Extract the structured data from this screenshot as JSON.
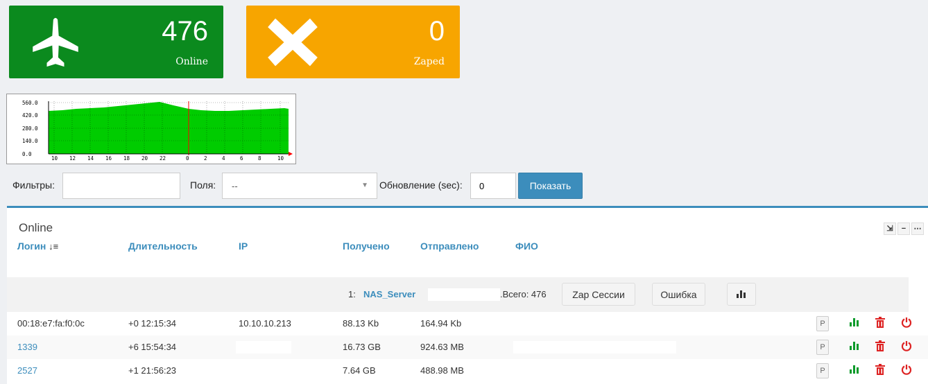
{
  "tiles": {
    "online": {
      "value": "476",
      "label": "Online",
      "icon": "plane-icon",
      "color": "#0b8a1e"
    },
    "zaped": {
      "value": "0",
      "label": "Zaped",
      "icon": "x-icon",
      "color": "#f7a500"
    }
  },
  "graph": {
    "y_ticks": [
      "560.0",
      "420.0",
      "280.0",
      "140.0",
      "0.0"
    ],
    "x_ticks": [
      "10",
      "12",
      "14",
      "16",
      "18",
      "20",
      "22",
      "0",
      "2",
      "4",
      "6",
      "8",
      "10"
    ],
    "fill_color": "#00cc00"
  },
  "filters": {
    "filter_label": "Фильтры:",
    "filter_value": "",
    "fields_label": "Поля:",
    "fields_value": "--",
    "refresh_label": "Обновление (sec):",
    "refresh_value": "0",
    "show_button": "Показать"
  },
  "panel": {
    "title": "Online",
    "columns": [
      "Логин",
      "Длительность",
      "IP",
      "Получено",
      "Отправлено",
      "ФИО"
    ],
    "group": {
      "number": "1:",
      "server": "NAS_Server",
      "total": ".Всего: 476",
      "zap_button": "Zap Сессии",
      "error_button": "Ошибка"
    },
    "rows": [
      {
        "login": "00:18:e7:fa:f0:0c",
        "duration": "+0 12:15:34",
        "ip": "10.10.10.213",
        "received": "88.13 Kb",
        "sent": "164.94 Kb",
        "fio": ""
      },
      {
        "login": "1339",
        "duration": "+6 15:54:34",
        "ip": "",
        "received": "16.73 GB",
        "sent": "924.63 MB",
        "fio": ""
      },
      {
        "login": "2527",
        "duration": "+1 21:56:23",
        "ip": "",
        "received": "7.64 GB",
        "sent": "488.98 MB",
        "fio": ""
      }
    ],
    "row_action_label": "P"
  }
}
